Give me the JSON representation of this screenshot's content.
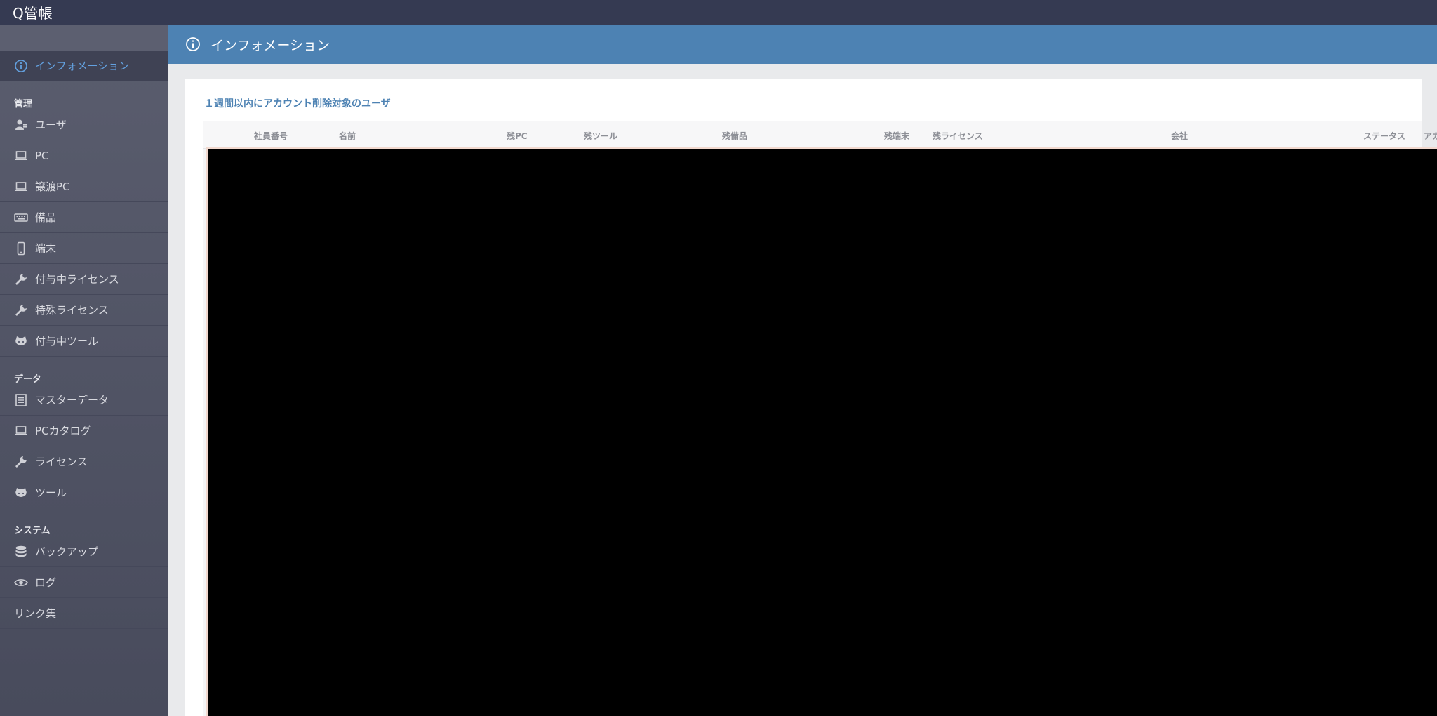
{
  "app": {
    "title": "Q管帳"
  },
  "sidebar": {
    "active": {
      "label": "インフォメーション",
      "icon": "info-circle-icon"
    },
    "sections": [
      {
        "label": "管理",
        "items": [
          {
            "label": "ユーザ",
            "icon": "user-icon"
          },
          {
            "label": "PC",
            "icon": "laptop-icon"
          },
          {
            "label": "譲渡PC",
            "icon": "laptop-icon"
          },
          {
            "label": "備品",
            "icon": "keyboard-icon"
          },
          {
            "label": "端末",
            "icon": "mobile-icon"
          },
          {
            "label": "付与中ライセンス",
            "icon": "wrench-icon"
          },
          {
            "label": "特殊ライセンス",
            "icon": "wrench-icon"
          },
          {
            "label": "付与中ツール",
            "icon": "github-icon"
          }
        ]
      },
      {
        "label": "データ",
        "items": [
          {
            "label": "マスターデータ",
            "icon": "list-icon"
          },
          {
            "label": "PCカタログ",
            "icon": "laptop-icon"
          },
          {
            "label": "ライセンス",
            "icon": "wrench-icon"
          },
          {
            "label": "ツール",
            "icon": "github-icon"
          }
        ]
      },
      {
        "label": "システム",
        "items": [
          {
            "label": "バックアップ",
            "icon": "database-icon"
          },
          {
            "label": "ログ",
            "icon": "eye-icon"
          }
        ]
      }
    ],
    "footer_link": "リンク集"
  },
  "header": {
    "title": "インフォメーション",
    "icon": "info-circle-icon"
  },
  "main": {
    "section_title": "１週間以内にアカウント削除対象のユーザ",
    "table": {
      "columns": [
        "社員番号",
        "名前",
        "残PC",
        "残ツール",
        "残備品",
        "残端末",
        "残ライセンス",
        "会社",
        "ステータス",
        "アカ"
      ]
    }
  },
  "colors": {
    "topbar": "#353a52",
    "sidebar": "#52556a",
    "accent": "#4d82b3",
    "active_text": "#63a1e0"
  }
}
